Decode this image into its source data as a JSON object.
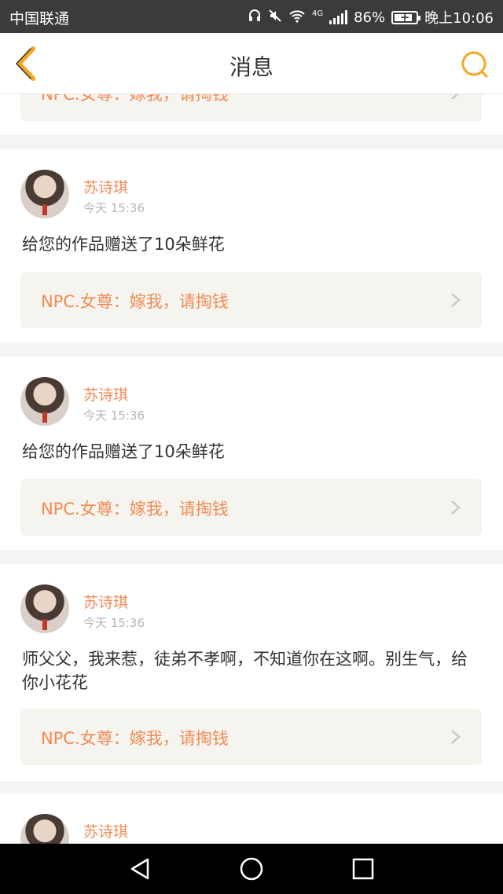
{
  "status_bar": {
    "carrier": "中国联通",
    "network": "4G",
    "battery": "86%",
    "battery_level": 0.86,
    "time": "晚上10:06",
    "icons": [
      "headset-icon",
      "mute-icon",
      "wifi-icon",
      "signal-icon",
      "battery-icon"
    ]
  },
  "header": {
    "title": "消息",
    "back_icon": "chevron-left-icon",
    "search_icon": "search-icon",
    "accent_color": "#f5a623"
  },
  "colors": {
    "name": "#f08b55",
    "quote_bg": "#f6f4ee",
    "page_bg": "#f4f4f4"
  },
  "partial_top_card": {
    "quote": "NPC.女尊：嫁我，请掏钱"
  },
  "messages": [
    {
      "name": "苏诗琪",
      "time": "今天  15:36",
      "text": "给您的作品赠送了10朵鲜花",
      "quote": "NPC.女尊：嫁我，请掏钱"
    },
    {
      "name": "苏诗琪",
      "time": "今天  15:36",
      "text": "给您的作品赠送了10朵鲜花",
      "quote": "NPC.女尊：嫁我，请掏钱"
    },
    {
      "name": "苏诗琪",
      "time": "今天  15:36",
      "text": "师父父，我来惹，徒弟不孝啊，不知道你在这啊。别生气，给你小花花",
      "quote": "NPC.女尊：嫁我，请掏钱"
    },
    {
      "name": "苏诗琪"
    }
  ],
  "nav_bar": {
    "buttons": [
      "back-triangle-icon",
      "home-circle-icon",
      "recents-square-icon"
    ]
  }
}
